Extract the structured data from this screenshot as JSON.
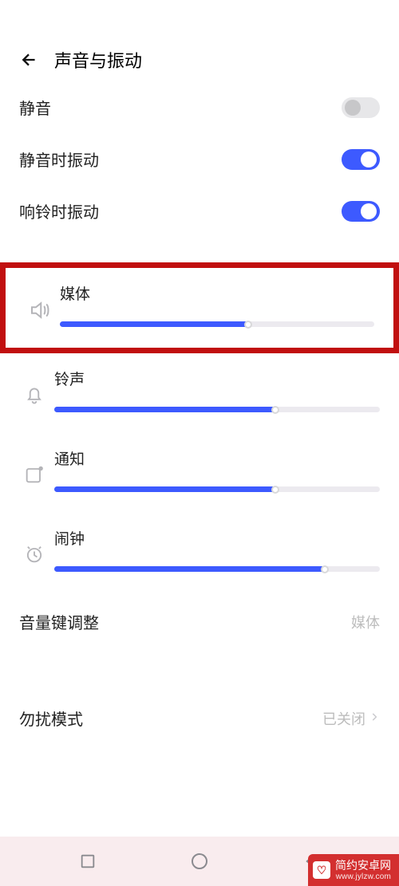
{
  "header": {
    "title": "声音与振动"
  },
  "toggles": {
    "mute": {
      "label": "静音",
      "on": false
    },
    "vibrate_on_mute": {
      "label": "静音时振动",
      "on": true
    },
    "vibrate_on_ring": {
      "label": "响铃时振动",
      "on": true
    }
  },
  "sliders": {
    "media": {
      "label": "媒体",
      "percent": 60
    },
    "ringtone": {
      "label": "铃声",
      "percent": 68
    },
    "notify": {
      "label": "通知",
      "percent": 68
    },
    "alarm": {
      "label": "闹钟",
      "percent": 83
    }
  },
  "rows": {
    "volume_key": {
      "label": "音量键调整",
      "value": "媒体"
    },
    "dnd": {
      "label": "勿扰模式",
      "value": "已关闭"
    }
  },
  "watermark": {
    "name": "简约安卓网",
    "url": "www.jylzw.com"
  }
}
